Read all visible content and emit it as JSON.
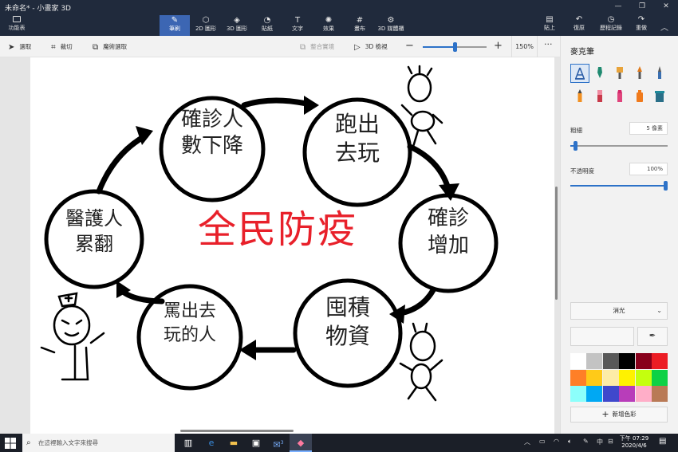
{
  "window": {
    "title": "未命名* - 小畫家 3D",
    "controls": [
      "—",
      "❐",
      "✕"
    ]
  },
  "ribbon": {
    "menu_label": "功能表",
    "tabs": [
      {
        "label": "筆刷",
        "icon": "brush-icon",
        "glyph": "✎",
        "active": true
      },
      {
        "label": "2D 圖形",
        "icon": "shapes-2d-icon",
        "glyph": "⬡",
        "active": false
      },
      {
        "label": "3D 圖形",
        "icon": "shapes-3d-icon",
        "glyph": "◈",
        "active": false
      },
      {
        "label": "貼紙",
        "icon": "sticker-icon",
        "glyph": "◔",
        "active": false
      },
      {
        "label": "文字",
        "icon": "text-icon",
        "glyph": "T",
        "active": false
      },
      {
        "label": "效果",
        "icon": "effects-icon",
        "glyph": "✺",
        "active": false
      },
      {
        "label": "畫布",
        "icon": "canvas-icon",
        "glyph": "#",
        "active": false
      },
      {
        "label": "3D 媒體櫃",
        "icon": "library-3d-icon",
        "glyph": "⚙",
        "active": false
      }
    ],
    "actions": [
      {
        "label": "貼上",
        "icon": "paste-icon",
        "glyph": "▤"
      },
      {
        "label": "復原",
        "icon": "undo-icon",
        "glyph": "↶"
      },
      {
        "label": "歷程記錄",
        "icon": "history-icon",
        "glyph": "◷"
      },
      {
        "label": "重做",
        "icon": "redo-icon",
        "glyph": "↷"
      }
    ]
  },
  "toolbar": {
    "select": "選取",
    "crop": "裁切",
    "magic_select": "魔術選取",
    "group": "整合實境",
    "view_3d": "3D 檢視",
    "zoom": "150%",
    "zoom_level": 0.5
  },
  "drawing": {
    "title": "全民防疫",
    "title_color": "#e8202a",
    "nodes": [
      "確診人 數下降",
      "跑出 去玩",
      "確診 增加",
      "囤積 物資",
      "罵出去 玩的人",
      "醫護人 累翻"
    ]
  },
  "panel": {
    "title": "麥克筆",
    "thickness_label": "粗細",
    "thickness_value": "5 像素",
    "thickness_level": 0.05,
    "opacity_label": "不透明度",
    "opacity_value": "100%",
    "opacity_level": 1.0,
    "finish": "消光",
    "add_color": "新增色彩",
    "accent": "#2d72c8",
    "swatches": [
      "#ffffff",
      "#c3c3c3",
      "#585858",
      "#000000",
      "#88001b",
      "#ec1c24",
      "#ff7f27",
      "#ffca18",
      "#fdeca6",
      "#fff200",
      "#c4ff0e",
      "#0ed145",
      "#8cfffb",
      "#00a8f3",
      "#3f48cc",
      "#b83dba",
      "#ffaec8",
      "#b97a56"
    ]
  },
  "taskbar": {
    "search_placeholder": "在這裡輸入文字來搜尋",
    "time": "下午 07:29",
    "date": "2020/4/6",
    "mail_badge": "3"
  }
}
